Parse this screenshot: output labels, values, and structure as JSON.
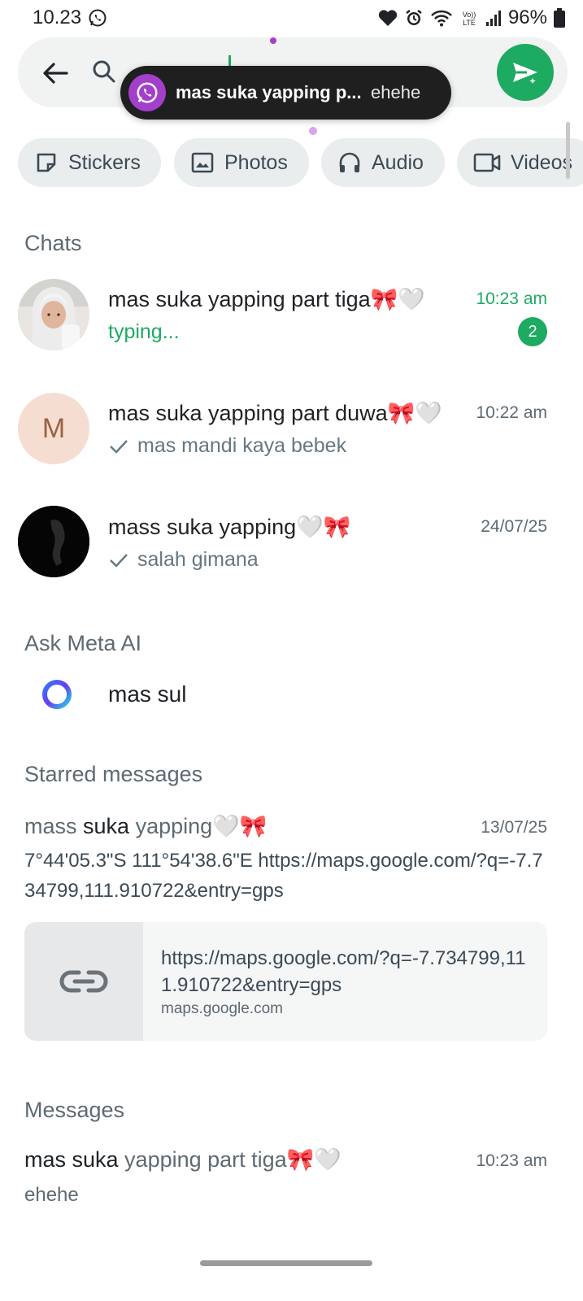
{
  "status_bar": {
    "time": "10.23",
    "battery": "96%"
  },
  "toast": {
    "title": "mas suka yapping p...",
    "message": "ehehe"
  },
  "chips": [
    {
      "label": "Stickers",
      "icon": "sticker-icon"
    },
    {
      "label": "Photos",
      "icon": "photo-icon"
    },
    {
      "label": "Audio",
      "icon": "headphones-icon"
    },
    {
      "label": "Videos",
      "icon": "video-icon"
    }
  ],
  "sections": {
    "chats": "Chats",
    "meta": "Ask Meta AI",
    "starred": "Starred messages",
    "messages": "Messages"
  },
  "chats": [
    {
      "name": "mas suka yapping part tiga🎀🤍",
      "time": "10:23 am",
      "subtitle": "typing...",
      "unread": "2"
    },
    {
      "name": "mas suka yapping part duwa🎀🤍",
      "time": "10:22 am",
      "subtitle": "mas mandi kaya bebek",
      "avatar_letter": "M"
    },
    {
      "name": "mass suka yapping🤍🎀",
      "time": "24/07/25",
      "subtitle": "salah gimana"
    }
  ],
  "meta_ai": {
    "query": "mas sul"
  },
  "starred": {
    "sender_plain_1": "mass ",
    "sender_highlight": "suka",
    "sender_plain_2": " yapping🤍🎀",
    "date": "13/07/25",
    "text": "7°44'05.3\"S 111°54'38.6\"E https://maps.google.com/?q=-7.734799,111.910722&entry=gps",
    "link_url": "https://maps.google.com/?q=-7.734799,111.910722&entry=gps",
    "link_domain": "maps.google.com"
  },
  "message": {
    "name_highlight": "mas suka",
    "name_rest": " yapping part tiga🎀🤍",
    "time": "10:23 am",
    "text": "ehehe"
  },
  "colors": {
    "accent": "#1daa61",
    "toast_bg": "#1f1f1f",
    "toast_avatar": "#a43fcb"
  }
}
